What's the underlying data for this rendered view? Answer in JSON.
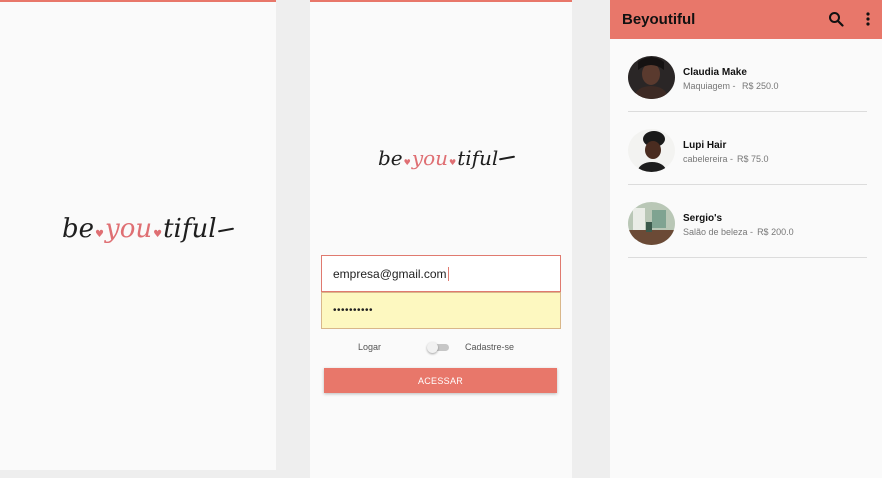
{
  "brand": {
    "logo_be": "be",
    "logo_you": "you",
    "logo_tiful": "tiful",
    "accent_color": "#e8776a"
  },
  "login": {
    "email_value": "empresa@gmail.com",
    "password_mask": "••••••••••",
    "toggle_left_label": "Logar",
    "toggle_right_label": "Cadastre-se",
    "submit_label": "ACESSAR"
  },
  "list_screen": {
    "title": "Beyoutiful",
    "icons": [
      "search-icon",
      "more-vert-icon"
    ],
    "items": [
      {
        "name": "Claudia Make",
        "category": "Maquiagem  - ",
        "price": "R$ 250.0"
      },
      {
        "name": "Lupi Hair",
        "category": "cabelereira -",
        "price": "R$ 75.0"
      },
      {
        "name": "Sergio's",
        "category": "Salão de beleza -",
        "price": "R$ 200.0"
      }
    ]
  }
}
